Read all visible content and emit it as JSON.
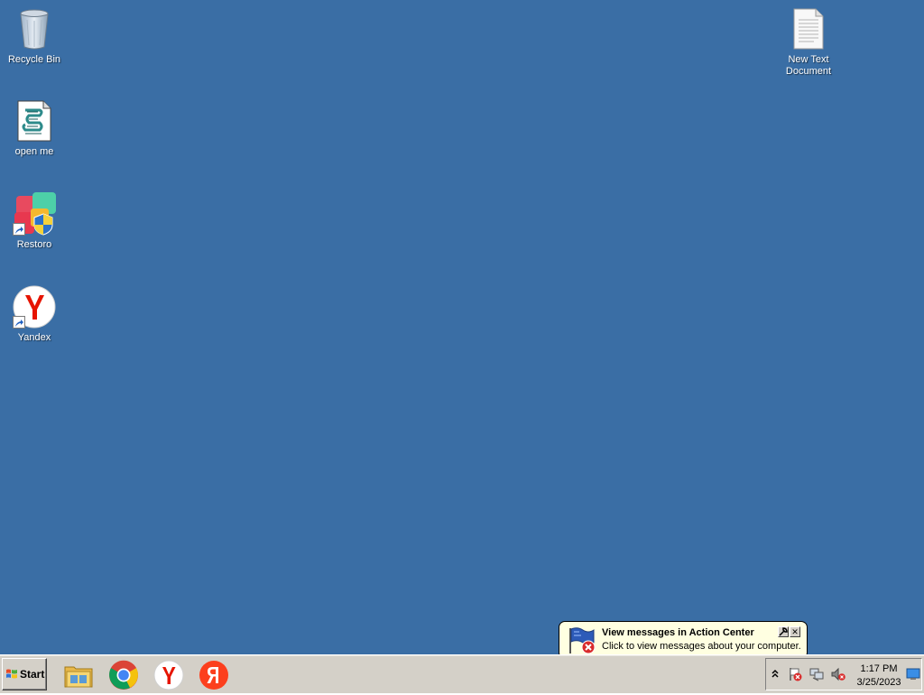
{
  "desktop": {
    "background": "#3a6ea5",
    "icons": [
      {
        "label": "Recycle Bin",
        "icon": "recycle-bin-icon"
      },
      {
        "label": "open me",
        "icon": "script-file-icon"
      },
      {
        "label": "Restoro",
        "icon": "restoro-icon"
      },
      {
        "label": "Yandex",
        "icon": "yandex-browser-icon"
      },
      {
        "label": "New Text Document",
        "icon": "text-document-icon"
      }
    ]
  },
  "taskbar": {
    "start_label": "Start",
    "pinned_apps": [
      "file-explorer-icon",
      "chrome-icon",
      "yandex-browser-icon",
      "yandex-icon"
    ],
    "clock": {
      "time": "1:17 PM",
      "date": "3/25/2023"
    },
    "tray_icons": [
      "show-hidden-icons-icon",
      "action-center-flag-icon",
      "network-icon",
      "volume-muted-icon",
      "show-desktop-icon"
    ]
  },
  "balloon": {
    "title": "View messages in Action Center",
    "text": "Click to view messages about your computer.",
    "close_symbol": "✕"
  }
}
